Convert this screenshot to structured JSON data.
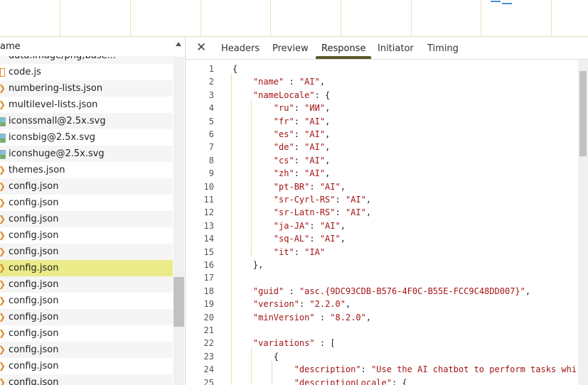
{
  "left": {
    "header": "ame",
    "rows": [
      {
        "name": "data:image/png;base...",
        "icon": "image-icon"
      },
      {
        "name": "code.js",
        "icon": "js-icon"
      },
      {
        "name": "numbering-lists.json",
        "icon": "json-icon"
      },
      {
        "name": "multilevel-lists.json",
        "icon": "json-icon"
      },
      {
        "name": "iconssmall@2.5x.svg",
        "icon": "image-icon"
      },
      {
        "name": "iconsbig@2.5x.svg",
        "icon": "image-icon"
      },
      {
        "name": "iconshuge@2.5x.svg",
        "icon": "image-icon"
      },
      {
        "name": "themes.json",
        "icon": "json-icon"
      },
      {
        "name": "config.json",
        "icon": "json-icon"
      },
      {
        "name": "config.json",
        "icon": "json-icon"
      },
      {
        "name": "config.json",
        "icon": "json-icon"
      },
      {
        "name": "config.json",
        "icon": "json-icon"
      },
      {
        "name": "config.json",
        "icon": "json-icon"
      },
      {
        "name": "config.json",
        "icon": "json-icon",
        "selected": true
      },
      {
        "name": "config.json",
        "icon": "json-icon"
      },
      {
        "name": "config.json",
        "icon": "json-icon"
      },
      {
        "name": "config.json",
        "icon": "json-icon"
      },
      {
        "name": "config.json",
        "icon": "json-icon"
      },
      {
        "name": "config.json",
        "icon": "json-icon"
      },
      {
        "name": "config.json",
        "icon": "json-icon"
      },
      {
        "name": "config.json",
        "icon": "json-icon"
      }
    ]
  },
  "tabs": {
    "close": "✕",
    "headers": "Headers",
    "preview": "Preview",
    "response": "Response",
    "initiator": "Initiator",
    "timing": "Timing"
  },
  "code": {
    "lines": [
      "{",
      "    \"name\" : \"AI\",",
      "    \"nameLocale\": {",
      "        \"ru\": \"ИИ\",",
      "        \"fr\": \"AI\",",
      "        \"es\": \"AI\",",
      "        \"de\": \"AI\",",
      "        \"cs\": \"AI\",",
      "        \"zh\": \"AI\",",
      "        \"pt-BR\": \"AI\",",
      "        \"sr-Cyrl-RS\": \"AI\",",
      "        \"sr-Latn-RS\": \"AI\",",
      "        \"ja-JA\": \"AI\",",
      "        \"sq-AL\": \"AI\",",
      "        \"it\": \"IA\"",
      "    },",
      "",
      "    \"guid\" : \"asc.{9DC93CDB-B576-4F0C-B55E-FCC9C48DD007}\",",
      "    \"version\": \"2.2.0\",",
      "    \"minVersion\" : \"8.2.0\",",
      "",
      "    \"variations\" : [",
      "        {",
      "            \"description\": \"Use the AI chatbot to perform tasks whi",
      "            \"descriptionLocale\": {"
    ]
  },
  "colors": {
    "selected_row": "#ebeb8a",
    "json_icon": "#e08a28",
    "tab_underline": "#5a5a2a"
  }
}
